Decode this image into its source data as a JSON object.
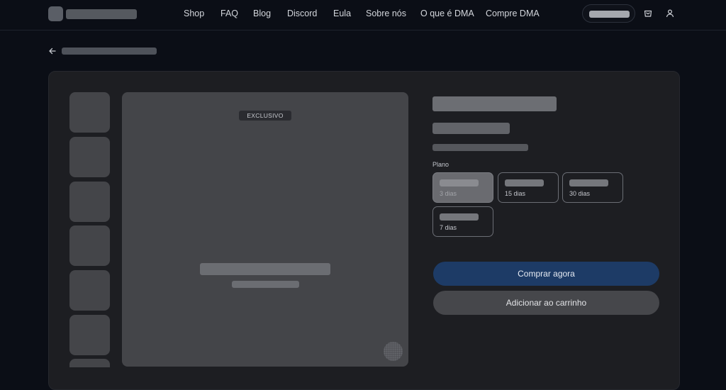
{
  "header": {
    "nav": [
      {
        "label": "Shop"
      },
      {
        "label": "FAQ"
      },
      {
        "label": "Blog"
      },
      {
        "label": "Discord"
      },
      {
        "label": "Eula"
      },
      {
        "label": "Sobre nós"
      },
      {
        "label": "O que é DMA"
      },
      {
        "label": "Compre DMA"
      }
    ],
    "icons": [
      "cart-icon",
      "user-icon"
    ]
  },
  "product": {
    "badge": "EXCLUSIVO",
    "plan_label": "Plano",
    "plans": [
      {
        "duration": "3 dias",
        "selected": true
      },
      {
        "duration": "15 dias",
        "selected": false
      },
      {
        "duration": "30 dias",
        "selected": false
      },
      {
        "duration": "7 dias",
        "selected": false
      }
    ],
    "buy_now": "Comprar agora",
    "add_to_cart": "Adicionar ao carrinho"
  },
  "colors": {
    "background": "#0b0e16",
    "card": "#1d1e22",
    "primary_button": "#1d3b66",
    "secondary_button": "#46474b"
  }
}
